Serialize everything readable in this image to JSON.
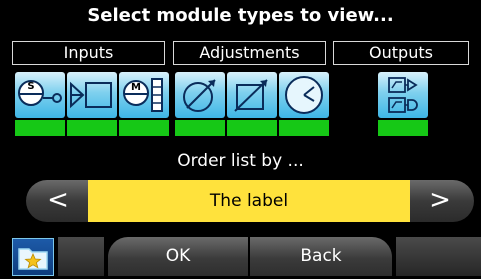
{
  "title": "Select module types to view...",
  "categories": {
    "inputs": "Inputs",
    "adjustments": "Adjustments",
    "outputs": "Outputs"
  },
  "module_tiles": [
    {
      "name": "sensor-input-icon",
      "glyph": "S",
      "active": true
    },
    {
      "name": "digital-input-icon",
      "active": true
    },
    {
      "name": "meter-input-icon",
      "glyph": "M",
      "active": true
    },
    {
      "name": "adjust-dial-icon",
      "active": true
    },
    {
      "name": "adjust-box-icon",
      "active": true
    },
    {
      "name": "adjust-timer-icon",
      "active": true
    },
    {
      "name": "output-relay-icon",
      "active": true
    }
  ],
  "order": {
    "label": "Order list by ...",
    "prev": "<",
    "next": ">",
    "value": "The label"
  },
  "buttons": {
    "ok": "OK",
    "back": "Back"
  },
  "colors": {
    "active_bar": "#16c816",
    "selection": "#ffe23c",
    "tile": "#7ed0ee"
  }
}
